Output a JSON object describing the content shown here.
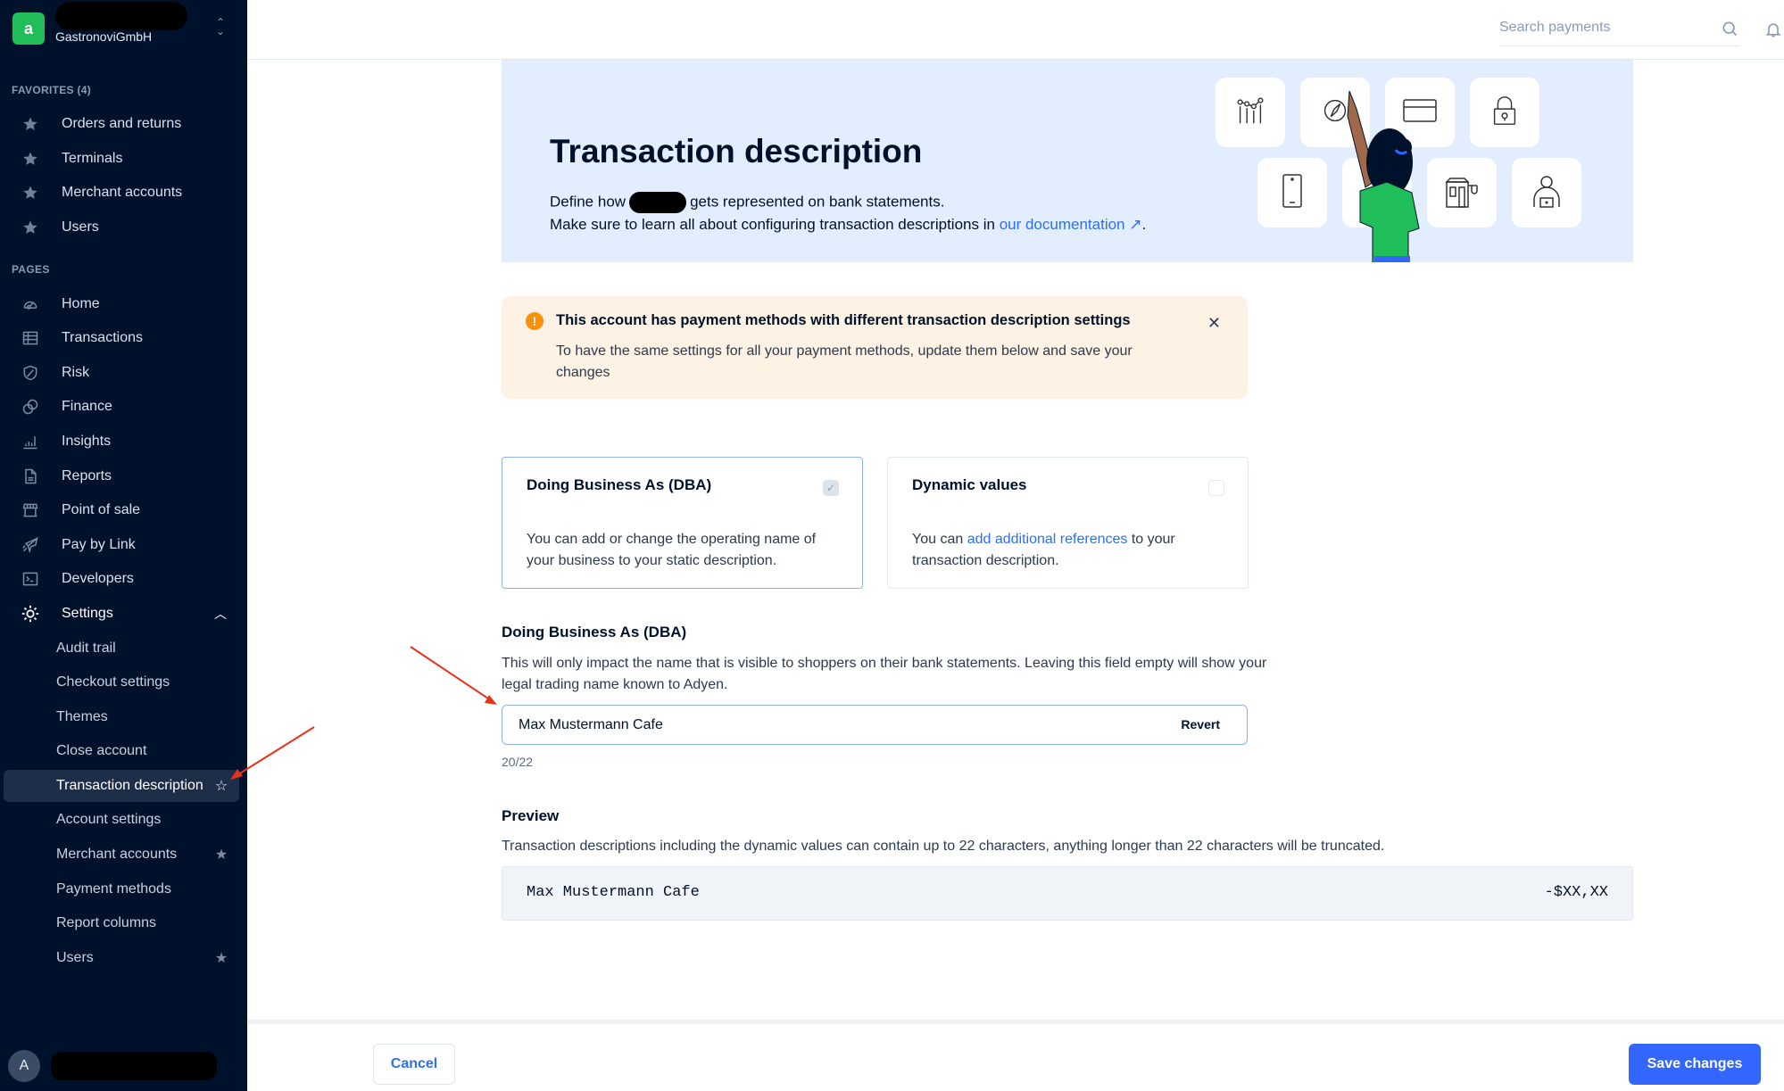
{
  "account": {
    "name": "GastronoviGmbH",
    "logo_letter": "a"
  },
  "sidebar": {
    "favorites_label": "FAVORITES (4)",
    "favorites": [
      {
        "label": "Orders and returns",
        "icon": "star-icon"
      },
      {
        "label": "Terminals",
        "icon": "star-icon"
      },
      {
        "label": "Merchant accounts",
        "icon": "star-icon"
      },
      {
        "label": "Users",
        "icon": "star-icon"
      }
    ],
    "pages_label": "PAGES",
    "pages": [
      {
        "label": "Home",
        "icon": "home-gauge-icon"
      },
      {
        "label": "Transactions",
        "icon": "table-icon"
      },
      {
        "label": "Risk",
        "icon": "shield-icon"
      },
      {
        "label": "Finance",
        "icon": "coins-icon"
      },
      {
        "label": "Insights",
        "icon": "bar-chart-icon"
      },
      {
        "label": "Reports",
        "icon": "document-icon"
      },
      {
        "label": "Point of sale",
        "icon": "store-icon"
      },
      {
        "label": "Pay by Link",
        "icon": "paper-plane-icon"
      },
      {
        "label": "Developers",
        "icon": "terminal-icon"
      },
      {
        "label": "Settings",
        "icon": "gear-icon",
        "expanded": true
      }
    ],
    "settings_sub": [
      {
        "label": "Audit trail",
        "starred": false
      },
      {
        "label": "Checkout settings",
        "starred": false
      },
      {
        "label": "Themes",
        "starred": false
      },
      {
        "label": "Close account",
        "starred": false
      },
      {
        "label": "Transaction description",
        "starred": false,
        "active": true
      },
      {
        "label": "Account settings",
        "starred": false
      },
      {
        "label": "Merchant accounts",
        "starred": true
      },
      {
        "label": "Payment methods",
        "starred": false
      },
      {
        "label": "Report columns",
        "starred": false
      },
      {
        "label": "Users",
        "starred": true
      }
    ],
    "user_initial": "A"
  },
  "topbar": {
    "search_placeholder": "Search payments"
  },
  "hero": {
    "title": "Transaction description",
    "line1_before": "Define how",
    "line1_after": "gets represented on bank statements.",
    "line2_before": "Make sure to learn all about configuring transaction descriptions in",
    "line2_link": "our documentation",
    "line2_link_icon": "↗",
    "line2_after": "."
  },
  "alert": {
    "icon": "!",
    "title": "This account has payment methods with different transaction description settings",
    "body": "To have the same settings for all your payment methods, update them below and save your changes"
  },
  "options": [
    {
      "title": "Doing Business As (DBA)",
      "desc": "You can add or change the operating name of your business to your static description.",
      "checked": true
    },
    {
      "title": "Dynamic values",
      "desc_before": "You can",
      "desc_link": "add additional references",
      "desc_after": "to your transaction description.",
      "checked": false
    }
  ],
  "dba_field": {
    "label": "Doing Business As (DBA)",
    "help": "This will only impact the name that is visible to shoppers on their bank statements. Leaving this field empty will show your legal trading name known to Adyen.",
    "value": "Max Mustermann Cafe",
    "revert_label": "Revert",
    "char_count": "20/22"
  },
  "preview": {
    "label": "Preview",
    "help": "Transaction descriptions including the dynamic values can contain up to 22 characters, anything longer than 22 characters will be truncated.",
    "name": "Max Mustermann Cafe",
    "amount": "-$XX,XX"
  },
  "footer": {
    "cancel_label": "Cancel",
    "save_label": "Save changes"
  },
  "colors": {
    "sidebar_bg": "#00112c",
    "brand_green": "#1fbe58",
    "primary_blue": "#3366ff",
    "link_blue": "#2d6ff0",
    "warning_orange": "#f8920e",
    "hero_bg": "#e2edfe",
    "alert_bg": "#fdf2e3",
    "annotation_red": "#e8331c"
  }
}
